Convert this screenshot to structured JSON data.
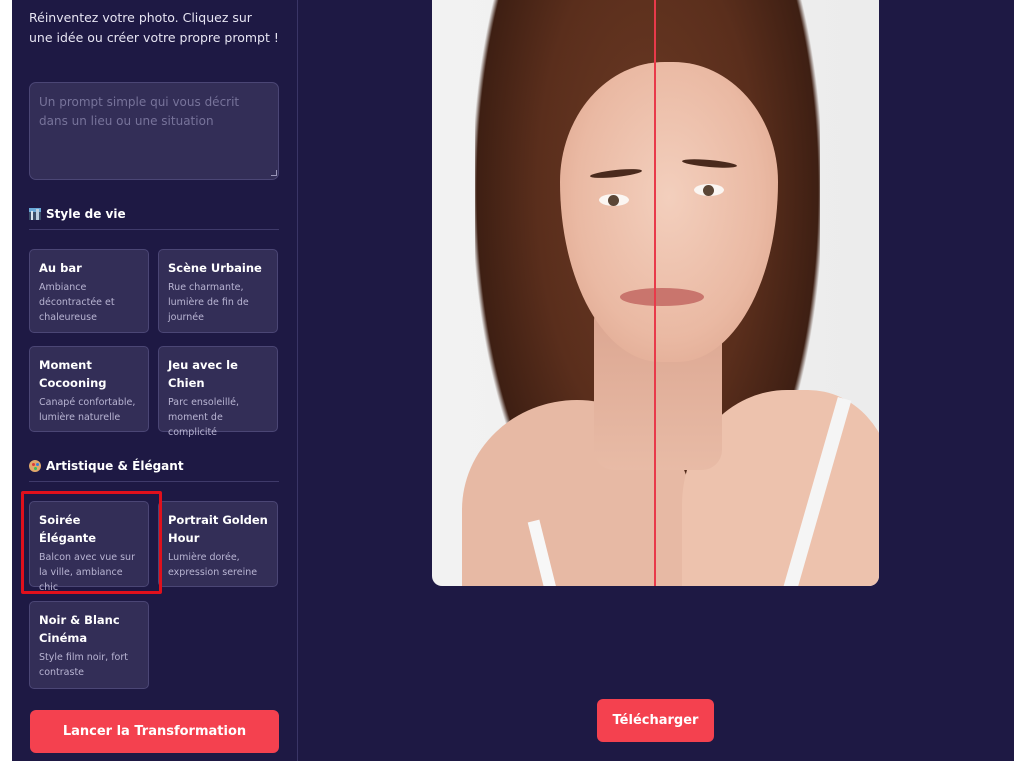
{
  "sidebar": {
    "intro": "Réinventez votre photo. Cliquez sur une idée ou créer votre propre prompt !",
    "prompt": {
      "placeholder": "Un prompt simple qui vous décrit dans un lieu ou une situation",
      "value": ""
    },
    "sections": [
      {
        "icon": "cityscape-icon",
        "title": "Style de vie",
        "cards": [
          {
            "title": "Au bar",
            "desc": "Ambiance décontractée et chaleureuse"
          },
          {
            "title": "Scène Urbaine",
            "desc": "Rue charmante, lumière de fin de journée"
          },
          {
            "title": "Moment Cocooning",
            "desc": "Canapé confortable, lumière naturelle"
          },
          {
            "title": "Jeu avec le Chien",
            "desc": "Parc ensoleillé, moment de complicité"
          }
        ]
      },
      {
        "icon": "palette-icon",
        "title": "Artistique & Élégant",
        "cards": [
          {
            "title": "Soirée Élégante",
            "desc": "Balcon avec vue sur la ville, ambiance chic",
            "highlighted": true
          },
          {
            "title": "Portrait Golden Hour",
            "desc": "Lumière dorée, expression sereine"
          },
          {
            "title": "Noir & Blanc Cinéma",
            "desc": "Style film noir, fort contraste"
          }
        ]
      }
    ],
    "launch_button": "Lancer la Transformation"
  },
  "main": {
    "download_button": "Télécharger"
  },
  "colors": {
    "background": "#1e1944",
    "card": "#332e57",
    "accent": "#f4414f",
    "highlight": "#e0101c",
    "divider": "#e83a4a"
  }
}
